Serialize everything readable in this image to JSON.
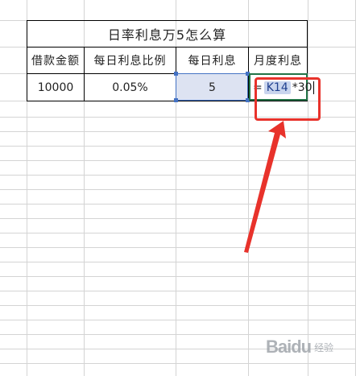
{
  "table": {
    "title": "日率利息万5怎么算",
    "headers": [
      "借款金额",
      "每日利息比例",
      "每日利息",
      "月度利息"
    ],
    "row": {
      "loan_amount": "10000",
      "daily_rate": "0.05%",
      "daily_interest": "5"
    }
  },
  "formula_bar": {
    "prefix": "=",
    "reference": "K14",
    "operator": "*",
    "multiplier": "30"
  },
  "colors": {
    "selection_fill": "#dde3f2",
    "selection_border": "#4472c4",
    "active_border": "#217346",
    "annotation_red": "#e8322b"
  },
  "watermark": {
    "logo": "Baidu",
    "text": "经验"
  }
}
